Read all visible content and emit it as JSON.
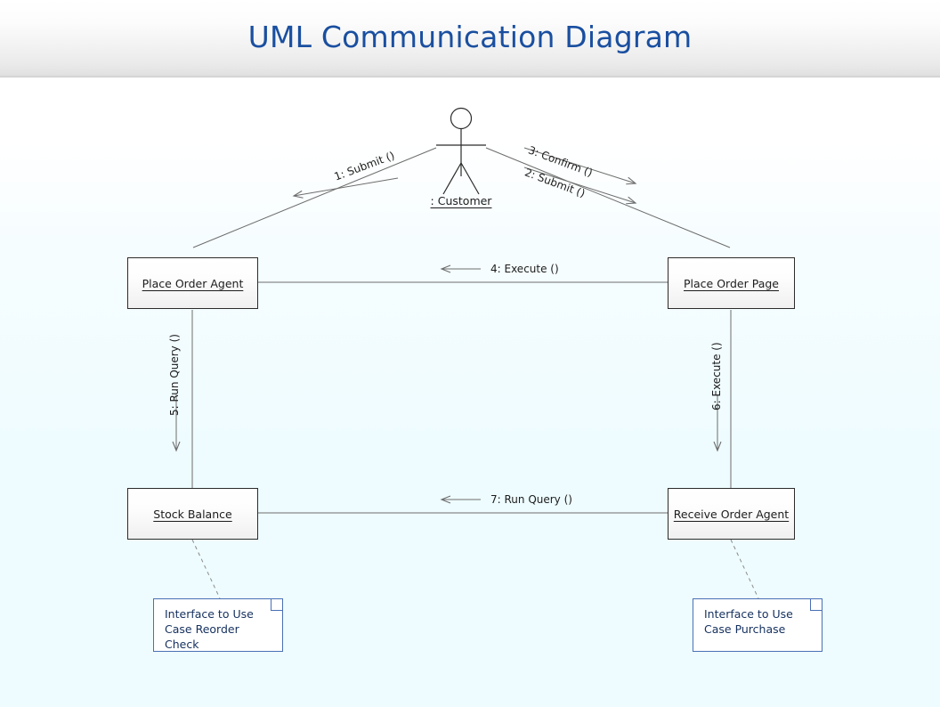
{
  "header": {
    "title": "UML Communication Diagram",
    "title_color": "#1a4fa0"
  },
  "diagram": {
    "actor": {
      "label": ": Customer",
      "icon": "actor-stick-figure"
    },
    "objects": [
      {
        "id": "place-order-agent",
        "label": "Place Order Agent"
      },
      {
        "id": "place-order-page",
        "label": "Place Order Page"
      },
      {
        "id": "stock-balance",
        "label": "Stock Balance"
      },
      {
        "id": "receive-order-agent",
        "label": "Receive Order Agent"
      }
    ],
    "messages": [
      {
        "id": "m1",
        "label": "1: Submit ()",
        "from": "Customer",
        "to": "Place Order Agent"
      },
      {
        "id": "m2",
        "label": "2: Submit ()",
        "from": "Customer",
        "to": "Place Order Page"
      },
      {
        "id": "m3",
        "label": "3: Confirm ()",
        "from": "Customer",
        "to": "Place Order Page"
      },
      {
        "id": "m4",
        "label": "4: Execute ()",
        "from": "Place Order Page",
        "to": "Place Order Agent"
      },
      {
        "id": "m5",
        "label": "5: Run Query ()",
        "from": "Place Order Agent",
        "to": "Stock Balance"
      },
      {
        "id": "m6",
        "label": "6: Execute ()",
        "from": "Place Order Page",
        "to": "Receive Order Agent"
      },
      {
        "id": "m7",
        "label": "7: Run Query ()",
        "from": "Receive Order Agent",
        "to": "Stock Balance"
      }
    ],
    "notes": [
      {
        "id": "note-reorder-check",
        "text": "Interface to Use\nCase Reorder\nCheck",
        "attached_to": "Stock Balance"
      },
      {
        "id": "note-purchase",
        "text": "Interface to Use\nCase Purchase",
        "attached_to": "Receive Order Agent"
      }
    ],
    "colors": {
      "line": "#6d6d6d",
      "box_border": "#2b2b2b",
      "note_border": "#4a6fb5",
      "note_text": "#15305e",
      "background_top": "#ffffff",
      "background_bottom": "#eefcff"
    }
  }
}
